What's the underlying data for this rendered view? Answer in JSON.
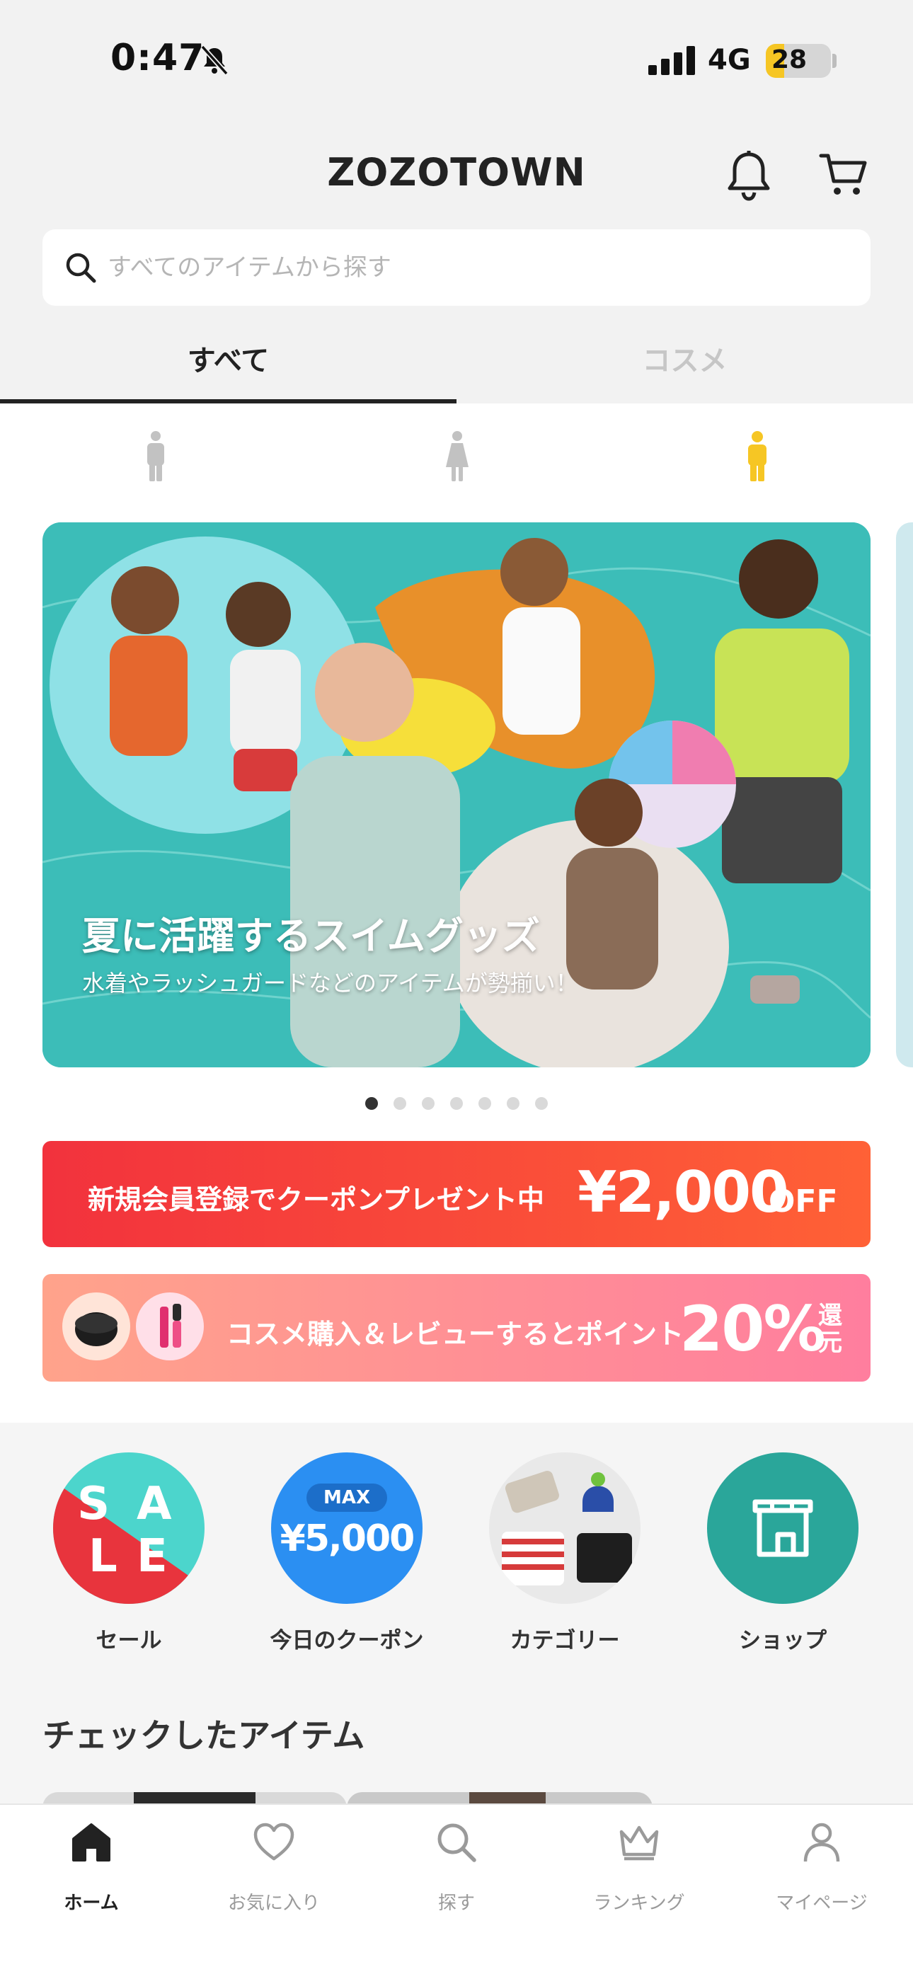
{
  "status_bar": {
    "time": "0:47",
    "network": "4G",
    "battery": "28",
    "battery_level": 0.28
  },
  "header": {
    "logo": "ZOZOTOWN",
    "search_placeholder": "すべてのアイテムから探す",
    "tabs": [
      {
        "label": "すべて",
        "active": true
      },
      {
        "label": "コスメ",
        "active": false
      }
    ]
  },
  "gender_filter": {
    "selected": "kids"
  },
  "banner": {
    "title": "夏に活躍するスイムグッズ",
    "subtitle": "水着やラッシュガードなどのアイテムが勢揃い！",
    "page_count": 7,
    "active_page": 1
  },
  "promo_signup": {
    "text": "新規会員登録でクーポンプレゼント中",
    "amount": "¥2,000",
    "suffix": "OFF"
  },
  "promo_cosme": {
    "text": "コスメ購入＆レビューするとポイント",
    "percent": "20%",
    "suffix": "還元"
  },
  "quick_menu": {
    "sale_letters": [
      "S",
      "A",
      "L",
      "E"
    ],
    "coupon_max": "MAX",
    "coupon_amount": "¥5,000",
    "items": [
      {
        "label": "セール"
      },
      {
        "label": "今日のクーポン"
      },
      {
        "label": "カテゴリー"
      },
      {
        "label": "ショップ"
      }
    ]
  },
  "section": {
    "title": "チェックしたアイテム"
  },
  "bottom_nav": [
    {
      "label": "ホーム",
      "icon": "home-icon",
      "active": true
    },
    {
      "label": "お気に入り",
      "icon": "heart-icon",
      "active": false
    },
    {
      "label": "探す",
      "icon": "search-icon",
      "active": false
    },
    {
      "label": "ランキング",
      "icon": "crown-icon",
      "active": false
    },
    {
      "label": "マイページ",
      "icon": "person-icon",
      "active": false
    }
  ],
  "colors": {
    "accent_yellow": "#f6c624",
    "sale_red": "#e8343d",
    "teal": "#2aa69a",
    "coupon_blue": "#2b8ff2",
    "promo_red": "#f2323d"
  }
}
